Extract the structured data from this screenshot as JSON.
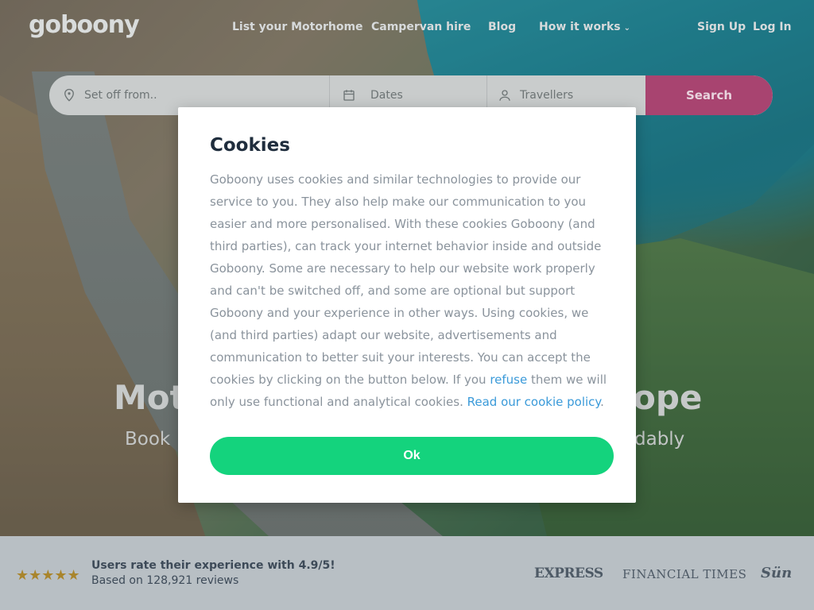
{
  "header": {
    "logo": "goboony",
    "nav": {
      "list": "List your Motorhome",
      "hire": "Campervan hire",
      "blog": "Blog",
      "how": "How it works"
    },
    "signup": "Sign Up",
    "login": "Log In"
  },
  "search": {
    "location_placeholder": "Set off from..",
    "dates_placeholder": "Dates",
    "travellers_placeholder": "Travellers",
    "button": "Search"
  },
  "hero": {
    "title_left": "Mot",
    "title_right": "ope",
    "sub_left": "Book",
    "sub_right": "dably"
  },
  "rating": {
    "stars": "★★★★★",
    "main": "Users rate their experience with 4.9/5!",
    "sub": "Based on 128,921 reviews"
  },
  "press": {
    "express": "EXPRESS",
    "ft": "FINANCIAL TIMES",
    "sun": "Sün"
  },
  "modal": {
    "title": "Cookies",
    "body_part1": "Goboony uses cookies and similar technologies to provide our service to you. They also help make our communication to you easier and more personalised. With these cookies Goboony (and third parties), can track your internet behavior inside and outside Goboony. Some are necessary to help our website work properly and can't be switched off, and some are optional but support Goboony and your experience in other ways. Using cookies, we (and third parties) adapt our website, advertisements and communication to better suit your interests. You can accept the cookies by clicking on the button below. If you ",
    "refuse_link": "refuse",
    "body_part2": " them we will only use functional and analytical cookies. ",
    "policy_link": "Read our cookie policy",
    "body_end": ".",
    "ok": "Ok"
  },
  "colors": {
    "ok_green": "#14d37d",
    "search_pink": "#a84470",
    "link_blue": "#3a9ad9"
  }
}
